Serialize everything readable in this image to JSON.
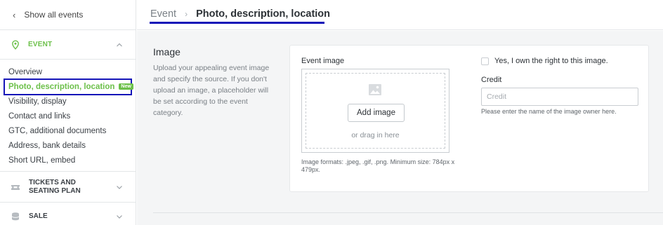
{
  "sidebar": {
    "back_label": "Show all events",
    "event_section": {
      "label": "EVENT",
      "icon": "location-pin-icon",
      "expanded": true
    },
    "nav_items": [
      {
        "label": "Overview"
      },
      {
        "label": "Photo, description, location",
        "badge": "New",
        "active": true
      },
      {
        "label": "Visibility, display"
      },
      {
        "label": "Contact and links"
      },
      {
        "label": "GTC, additional documents"
      },
      {
        "label": "Address, bank details"
      },
      {
        "label": "Short URL, embed"
      }
    ],
    "tickets_section": {
      "label": "TICKETS AND SEATING PLAN",
      "icon": "ticket-icon"
    },
    "sale_section": {
      "label": "SALE",
      "icon": "database-icon"
    }
  },
  "header": {
    "breadcrumb_parent": "Event",
    "breadcrumb_current": "Photo, description, location"
  },
  "image_section": {
    "title": "Image",
    "description": "Upload your appealing event image and specify the source. If you don't upload an image, a placeholder will be set according to the event category.",
    "event_image_label": "Event image",
    "add_image_label": "Add image",
    "drag_text": "or drag in here",
    "formats_text": "Image formats: .jpeg, .gif, .png. Minimum size: 784px x 479px.",
    "own_right_label": "Yes, I own the right to this image.",
    "credit_label": "Credit",
    "credit_placeholder": "Credit",
    "credit_value": "",
    "credit_hint": "Please enter the name of the image owner here."
  },
  "colors": {
    "accent_green": "#6cc04a",
    "highlight_blue": "#1515b8"
  }
}
